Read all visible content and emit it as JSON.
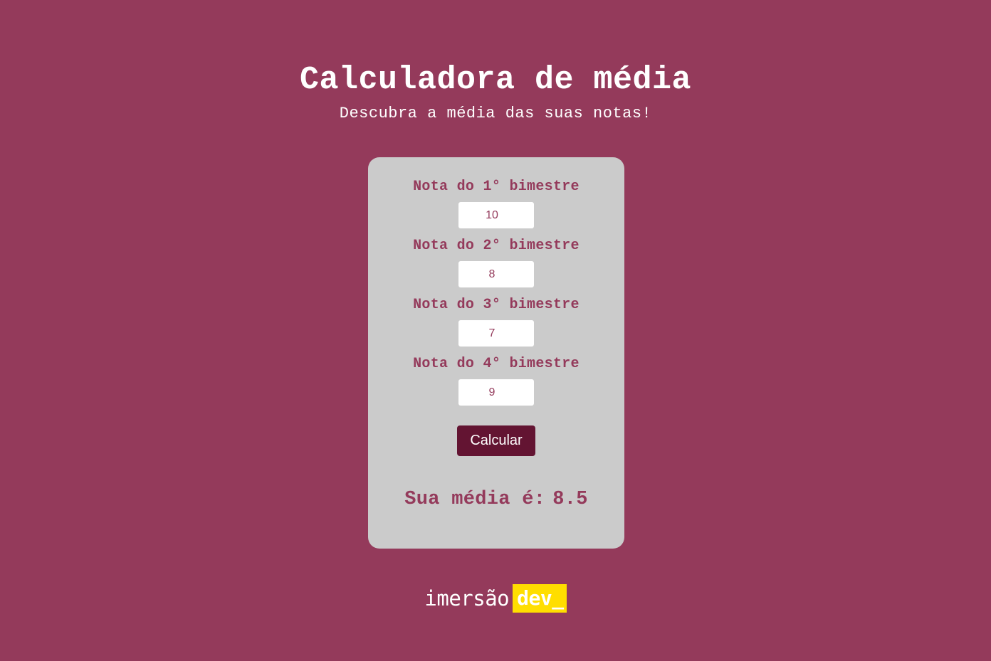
{
  "header": {
    "title": "Calculadora de média",
    "subtitle": "Descubra a média das suas notas!"
  },
  "form": {
    "fields": [
      {
        "label": "Nota do 1° bimestre",
        "value": "10"
      },
      {
        "label": "Nota do 2° bimestre",
        "value": "8"
      },
      {
        "label": "Nota do 3° bimestre",
        "value": "7"
      },
      {
        "label": "Nota do 4° bimestre",
        "value": "9"
      }
    ],
    "button_label": "Calcular",
    "result_label": "Sua média é:",
    "result_value": "8.5"
  },
  "footer": {
    "brand_text": "imersão",
    "brand_highlight": "dev_"
  },
  "colors": {
    "background": "#943a5b",
    "card": "#cbcbcb",
    "button": "#631432",
    "accent_yellow": "#ffde00"
  }
}
